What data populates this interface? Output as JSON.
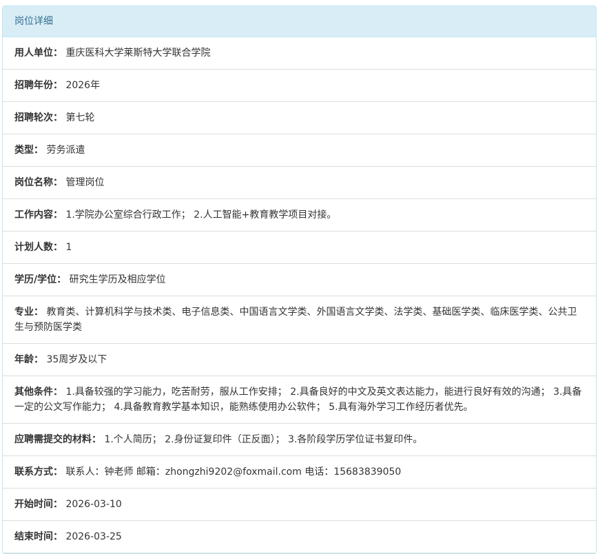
{
  "panel": {
    "title": "岗位详细"
  },
  "fields": [
    {
      "label": "用人单位：",
      "value": "重庆医科大学莱斯特大学联合学院"
    },
    {
      "label": "招聘年份：",
      "value": "2026年"
    },
    {
      "label": "招聘轮次：",
      "value": "第七轮"
    },
    {
      "label": "类型：",
      "value": "劳务派遣"
    },
    {
      "label": "岗位名称：",
      "value": "管理岗位"
    },
    {
      "label": "工作内容：",
      "value": "1.学院办公室综合行政工作； 2.人工智能+教育教学项目对接。"
    },
    {
      "label": "计划人数：",
      "value": "1"
    },
    {
      "label": "学历/学位：",
      "value": "研究生学历及相应学位"
    },
    {
      "label": "专业：",
      "value": "教育类、计算机科学与技术类、电子信息类、中国语言文学类、外国语言文学类、法学类、基础医学类、临床医学类、公共卫生与预防医学类"
    },
    {
      "label": "年龄：",
      "value": "35周岁及以下"
    },
    {
      "label": "其他条件：",
      "value": "1.具备较强的学习能力，吃苦耐劳，服从工作安排； 2.具备良好的中文及英文表达能力，能进行良好有效的沟通； 3.具备一定的公文写作能力； 4.具备教育教学基本知识，能熟练使用办公软件； 5.具有海外学习工作经历者优先。"
    },
    {
      "label": "应聘需提交的材料：",
      "value": "1.个人简历； 2.身份证复印件（正反面）； 3.各阶段学历学位证书复印件。"
    },
    {
      "label": "联系方式：",
      "value": "联系人：钟老师 邮箱：zhongzhi9202@foxmail.com 电话：15683839050"
    },
    {
      "label": "开始时间：",
      "value": "2026-03-10"
    },
    {
      "label": "结束时间：",
      "value": "2026-03-25"
    }
  ]
}
